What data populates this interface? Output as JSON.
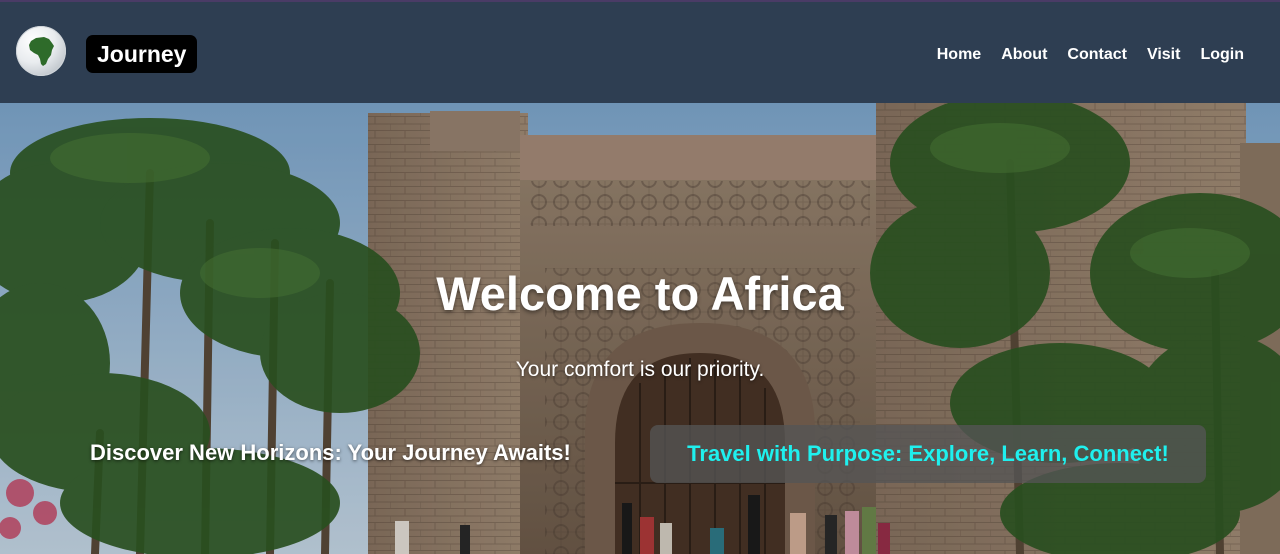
{
  "brand": {
    "logo_icon": "africa-globe-icon",
    "name": "Journey"
  },
  "nav": {
    "items": [
      {
        "label": "Home"
      },
      {
        "label": "About"
      },
      {
        "label": "Contact"
      },
      {
        "label": "Visit"
      },
      {
        "label": "Login"
      }
    ]
  },
  "hero": {
    "title": "Welcome to Africa",
    "subtitle": "Your comfort is our priority.",
    "tagline_left": "Discover New Horizons: Your Journey Awaits!",
    "tagline_right": "Travel with Purpose: Explore, Learn, Connect!"
  },
  "colors": {
    "navbar_bg": "#2e3e52",
    "brand_bg": "#000000",
    "tagline_right_text": "#1ff0ee",
    "text": "#ffffff"
  }
}
